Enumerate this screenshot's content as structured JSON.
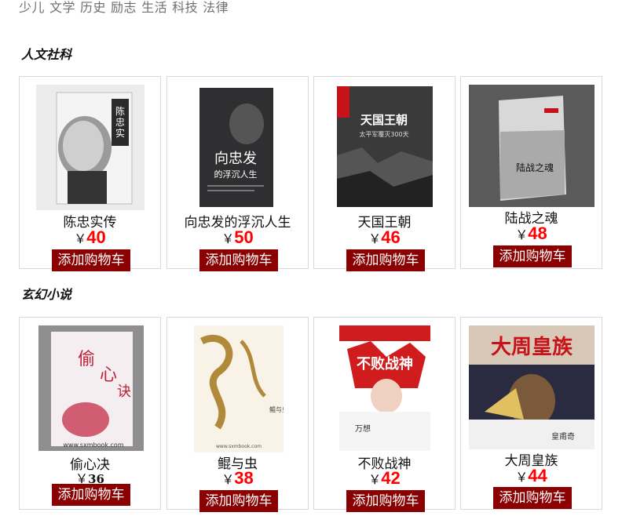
{
  "nav": {
    "items": [
      "少儿",
      "文学",
      "历史",
      "励志",
      "生活",
      "科技",
      "法律"
    ]
  },
  "sections": [
    {
      "title": "人文社科",
      "books": [
        {
          "title": "陈忠实传",
          "yen": "￥",
          "price": "40"
        },
        {
          "title": "向忠发的浮沉人生",
          "yen": "￥",
          "price": "50"
        },
        {
          "title": "天国王朝",
          "yen": "￥",
          "price": "46"
        },
        {
          "title": "陆战之魂",
          "yen": "￥",
          "price": "48"
        }
      ]
    },
    {
      "title": "玄幻小说",
      "books": [
        {
          "title": "偷心决",
          "yen": "￥",
          "price": "36"
        },
        {
          "title": "鲲与虫",
          "yen": "￥",
          "price": "38"
        },
        {
          "title": "不败战神",
          "yen": "￥",
          "price": "42"
        },
        {
          "title": "大周皇族",
          "yen": "￥",
          "price": "44"
        }
      ]
    }
  ],
  "cart_label": "添加购物车",
  "covers": {
    "s0b0": {
      "text": "陈忠实传",
      "bg": "#e9e9e9",
      "accent": "#2b2b2b"
    },
    "s0b1": {
      "text": "向忠发",
      "sub": "的浮沉人生",
      "bg": "#2f2f31",
      "accent": "#ffffff"
    },
    "s0b2": {
      "text": "天国王朝",
      "sub": "太平军覆灭300天",
      "bg": "#3a3a3a",
      "accent": "#c8121a"
    },
    "s0b3": {
      "text": "陆战之魂",
      "bg": "#5a5a5a",
      "accent": "#cfcfcf"
    },
    "s1b0": {
      "text": "偷心诀",
      "sub": "www.sxmbook.com",
      "bg": "#8f8f8f",
      "accent": "#c0203a"
    },
    "s1b1": {
      "text": "鲲与虫",
      "sub": "www.sxmbook.com",
      "bg": "#f8f3e6",
      "accent": "#b08a3a"
    },
    "s1b2": {
      "text": "不败战神",
      "sub": "万想",
      "bg": "#ffffff",
      "accent": "#d01c1c"
    },
    "s1b3": {
      "text": "大周皇族",
      "sub": "皇甫奇",
      "bg": "#2a2a40",
      "accent": "#e0c060"
    }
  }
}
